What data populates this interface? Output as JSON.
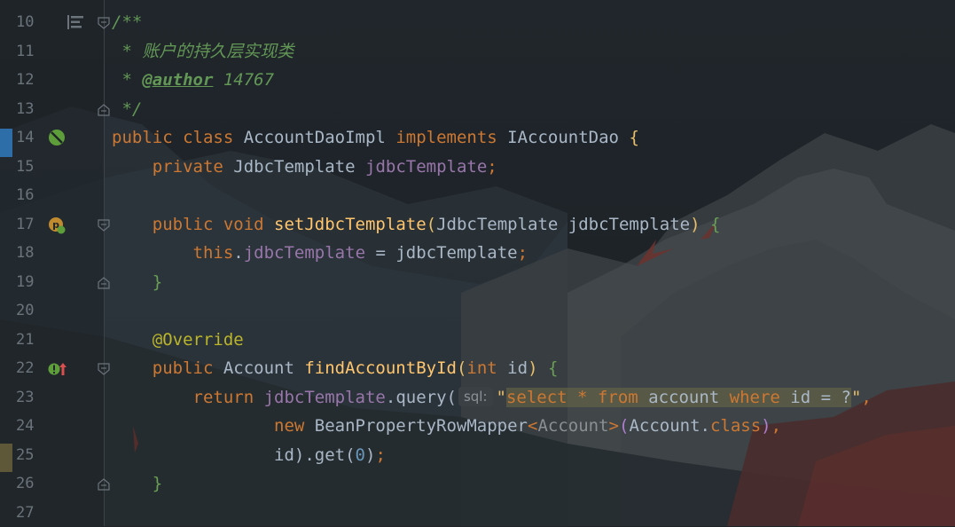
{
  "editor": {
    "lines": [
      {
        "num": "10",
        "segments": [
          "/**"
        ]
      },
      {
        "num": "11",
        "segments": [
          " * ",
          "账户的持久层实现类"
        ]
      },
      {
        "num": "12",
        "segments": [
          " * ",
          "@author",
          " 14767"
        ]
      },
      {
        "num": "13",
        "segments": [
          " */"
        ]
      },
      {
        "num": "14",
        "segments": [
          "public ",
          "class ",
          "AccountDaoImpl ",
          "implements ",
          "IAccountDao ",
          "{"
        ]
      },
      {
        "num": "15",
        "segments": [
          "    private ",
          "JdbcTemplate ",
          "jdbcTemplate",
          ";"
        ]
      },
      {
        "num": "16",
        "segments": [
          ""
        ]
      },
      {
        "num": "17",
        "segments": [
          "    public ",
          "void ",
          "setJdbcTemplate",
          "(",
          "JdbcTemplate jdbcTemplate",
          ")",
          " {"
        ]
      },
      {
        "num": "18",
        "segments": [
          "        this",
          ".",
          "jdbcTemplate",
          " = jdbcTemplate",
          ";"
        ]
      },
      {
        "num": "19",
        "segments": [
          "    }"
        ]
      },
      {
        "num": "20",
        "segments": [
          ""
        ]
      },
      {
        "num": "21",
        "segments": [
          "    @Override"
        ]
      },
      {
        "num": "22",
        "segments": [
          "    public ",
          "Account ",
          "findAccountById",
          "(",
          "int ",
          "id",
          ")",
          " {"
        ]
      },
      {
        "num": "23",
        "segments": [
          "        return ",
          "jdbcTemplate",
          ".query(",
          "sql:",
          "\"",
          "select",
          " * ",
          "from",
          " account ",
          "where",
          " id = ?",
          "\"",
          ","
        ]
      },
      {
        "num": "24",
        "segments": [
          "                new ",
          "BeanPropertyRowMapper",
          "<",
          "Account",
          ">",
          "(",
          "Account.",
          "class",
          ")",
          ","
        ]
      },
      {
        "num": "25",
        "segments": [
          "                id",
          ").get(",
          "0",
          ")",
          ";"
        ]
      },
      {
        "num": "26",
        "segments": [
          "    }"
        ]
      },
      {
        "num": "27",
        "segments": [
          ""
        ]
      }
    ]
  },
  "gutter": {
    "icons": {
      "line10": "structure-icon",
      "line14": "no-bean-icon",
      "line17": "setter-bean-icon",
      "line22": "implements-method-icon"
    }
  },
  "colors": {
    "keyword": "#cc7832",
    "function": "#ffc66d",
    "field": "#9876aa",
    "annotation": "#bbb529",
    "number": "#6897bb",
    "doc_comment": "#629755",
    "plain": "#a9b7c6",
    "line_number": "#6b747b"
  }
}
